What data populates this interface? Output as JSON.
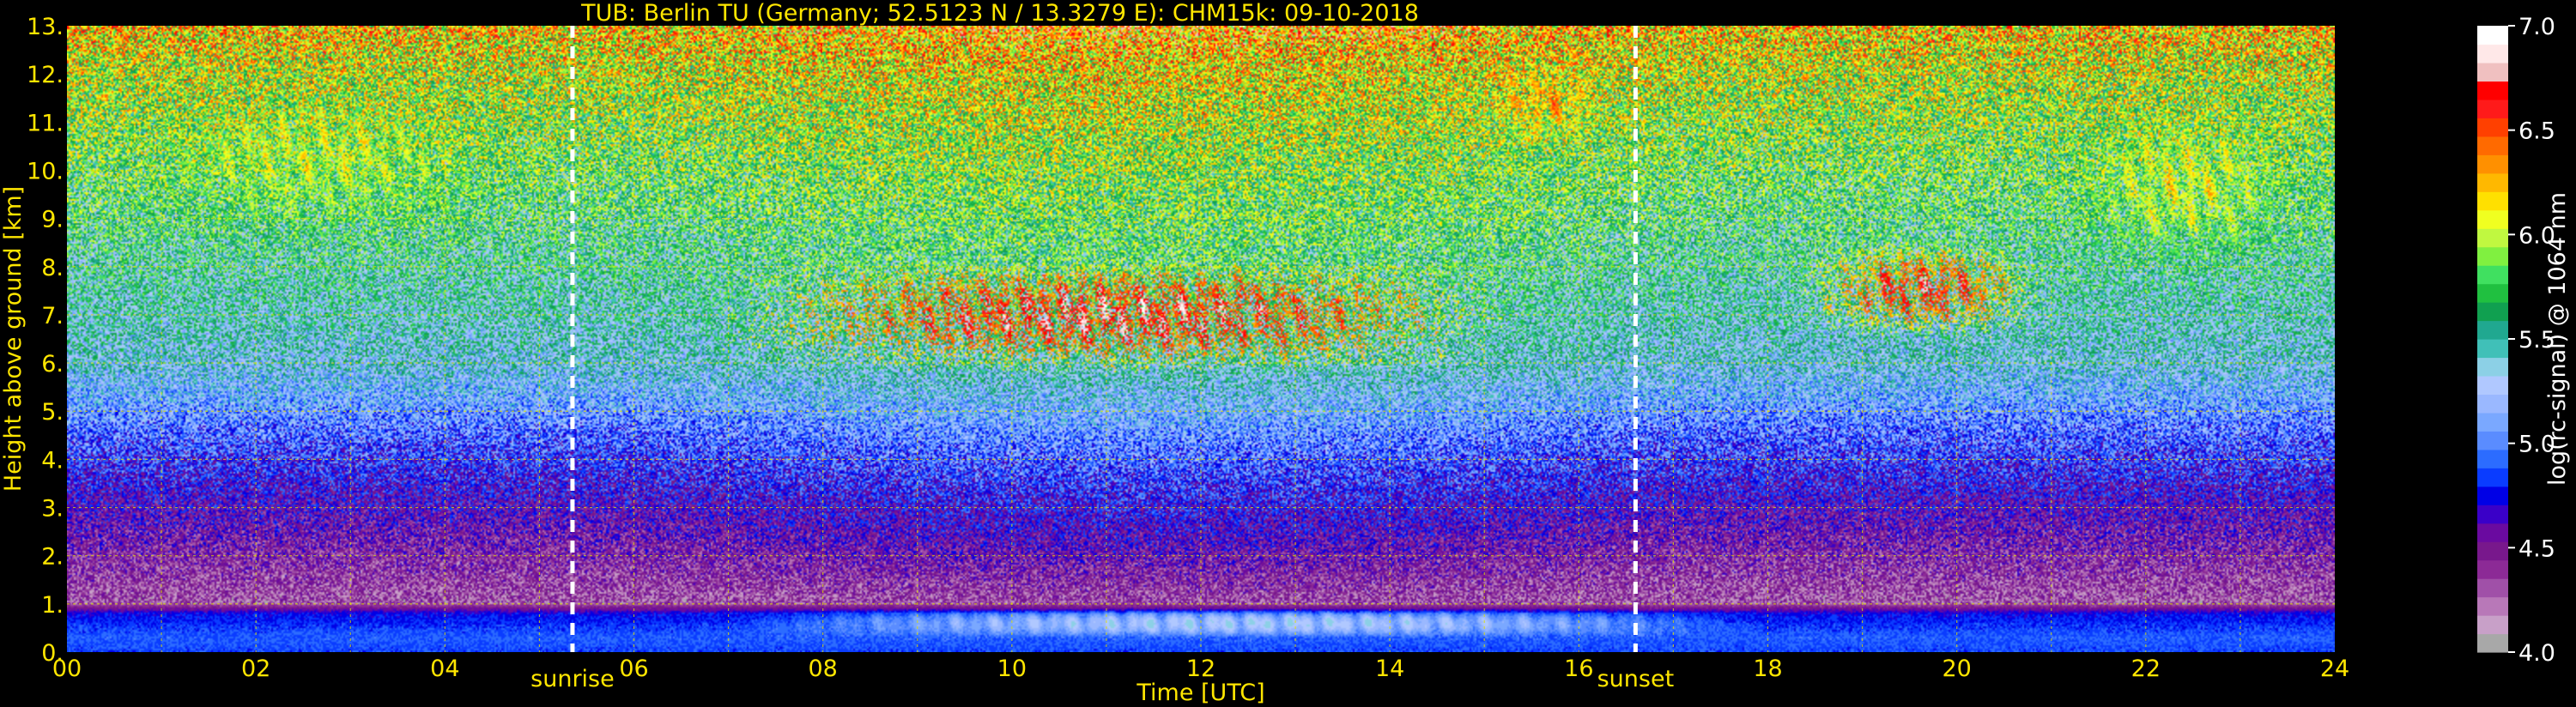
{
  "colors": {
    "background": "#000000",
    "axis_text": "#ffe600",
    "grid": "#e0e000",
    "colorbar_text": "#ffffff",
    "event_line": "#ffffff"
  },
  "chart_data": {
    "type": "heatmap",
    "title": "TUB: Berlin TU (Germany; 52.5123 N / 13.3279 E):    CHM15k: 09-10-2018",
    "xlabel": "Time [UTC]",
    "ylabel": "Height above ground [km]",
    "xlim": [
      0,
      24
    ],
    "ylim": [
      0,
      13
    ],
    "x_ticks": [
      0,
      2,
      4,
      6,
      8,
      10,
      12,
      14,
      16,
      18,
      20,
      22,
      24
    ],
    "x_tick_labels": [
      "00",
      "02",
      "04",
      "06",
      "08",
      "10",
      "12",
      "14",
      "16",
      "18",
      "20",
      "22",
      "24"
    ],
    "x_minor_step": 1,
    "y_ticks": [
      0,
      1,
      2,
      3,
      4,
      5,
      6,
      7,
      8,
      9,
      10,
      11,
      12,
      13
    ],
    "y_tick_labels": [
      "0.",
      "1.",
      "2.",
      "3.",
      "4.",
      "5.",
      "6.",
      "7.",
      "8.",
      "9.",
      "10.",
      "11.",
      "12.",
      "13."
    ],
    "grid": true,
    "colorbar": {
      "label": "log(rc-signal) @ 1064 nm",
      "range": [
        4.0,
        7.0
      ],
      "ticks": [
        4.0,
        4.5,
        5.0,
        5.5,
        6.0,
        6.5,
        7.0
      ],
      "tick_labels": [
        "4.0",
        "4.5",
        "5.0",
        "5.5",
        "6.0",
        "6.5",
        "7.0"
      ],
      "colors": [
        "#a8a8a8",
        "#c8a0c8",
        "#b878b8",
        "#a050a8",
        "#8c2a96",
        "#78188c",
        "#6a0aa0",
        "#3a00c8",
        "#0000e6",
        "#0a3cff",
        "#2c6cff",
        "#5a8cff",
        "#7aa8ff",
        "#9ab8ff",
        "#b0c8ff",
        "#8cd0e6",
        "#40c0b8",
        "#20a890",
        "#10a050",
        "#20c040",
        "#40e060",
        "#80f040",
        "#c0f840",
        "#f0ff20",
        "#ffe000",
        "#ffb800",
        "#ff9000",
        "#ff6a00",
        "#ff4000",
        "#ff1a1a",
        "#ff0000",
        "#f0c0c0",
        "#ffe8e8",
        "#ffffff"
      ]
    },
    "events": [
      {
        "label": "sunrise",
        "time": 5.35
      },
      {
        "label": "sunset",
        "time": 16.6
      }
    ],
    "layers": [
      {
        "kind": "background_gradient",
        "description_levels": [
          {
            "height": 0.0,
            "level": 4.85
          },
          {
            "height": 0.3,
            "level": 4.9
          },
          {
            "height": 0.8,
            "level": 4.75
          },
          {
            "height": 1.0,
            "level": 4.3
          },
          {
            "height": 2.0,
            "level": 4.45
          },
          {
            "height": 3.0,
            "level": 4.6
          },
          {
            "height": 4.5,
            "level": 4.95
          },
          {
            "height": 6.0,
            "level": 5.35
          },
          {
            "height": 8.0,
            "level": 5.55
          },
          {
            "height": 10.0,
            "level": 5.75
          },
          {
            "height": 12.0,
            "level": 6.0
          },
          {
            "height": 13.0,
            "level": 6.2
          }
        ]
      },
      {
        "kind": "cirrus_band",
        "t0": 0.0,
        "t1": 5.3,
        "h_low": 8.0,
        "h_high": 12.5,
        "level": 6.2
      },
      {
        "kind": "cirrus_band",
        "t0": 6.9,
        "t1": 15.3,
        "h_low": 5.8,
        "h_high": 8.2,
        "level": 6.9
      },
      {
        "kind": "cirrus_band",
        "t0": 14.8,
        "t1": 16.5,
        "h_low": 10.3,
        "h_high": 12.5,
        "level": 6.5
      },
      {
        "kind": "cirrus_band",
        "t0": 18.3,
        "t1": 21.0,
        "h_low": 6.5,
        "h_high": 8.6,
        "level": 6.8
      },
      {
        "kind": "cirrus_band",
        "t0": 20.8,
        "t1": 24.0,
        "h_low": 7.6,
        "h_high": 11.8,
        "level": 6.3
      },
      {
        "kind": "boundary_layer",
        "t0": 7.0,
        "t1": 18.0,
        "h_low": 0.3,
        "h_high": 0.9,
        "level": 5.45
      }
    ]
  }
}
